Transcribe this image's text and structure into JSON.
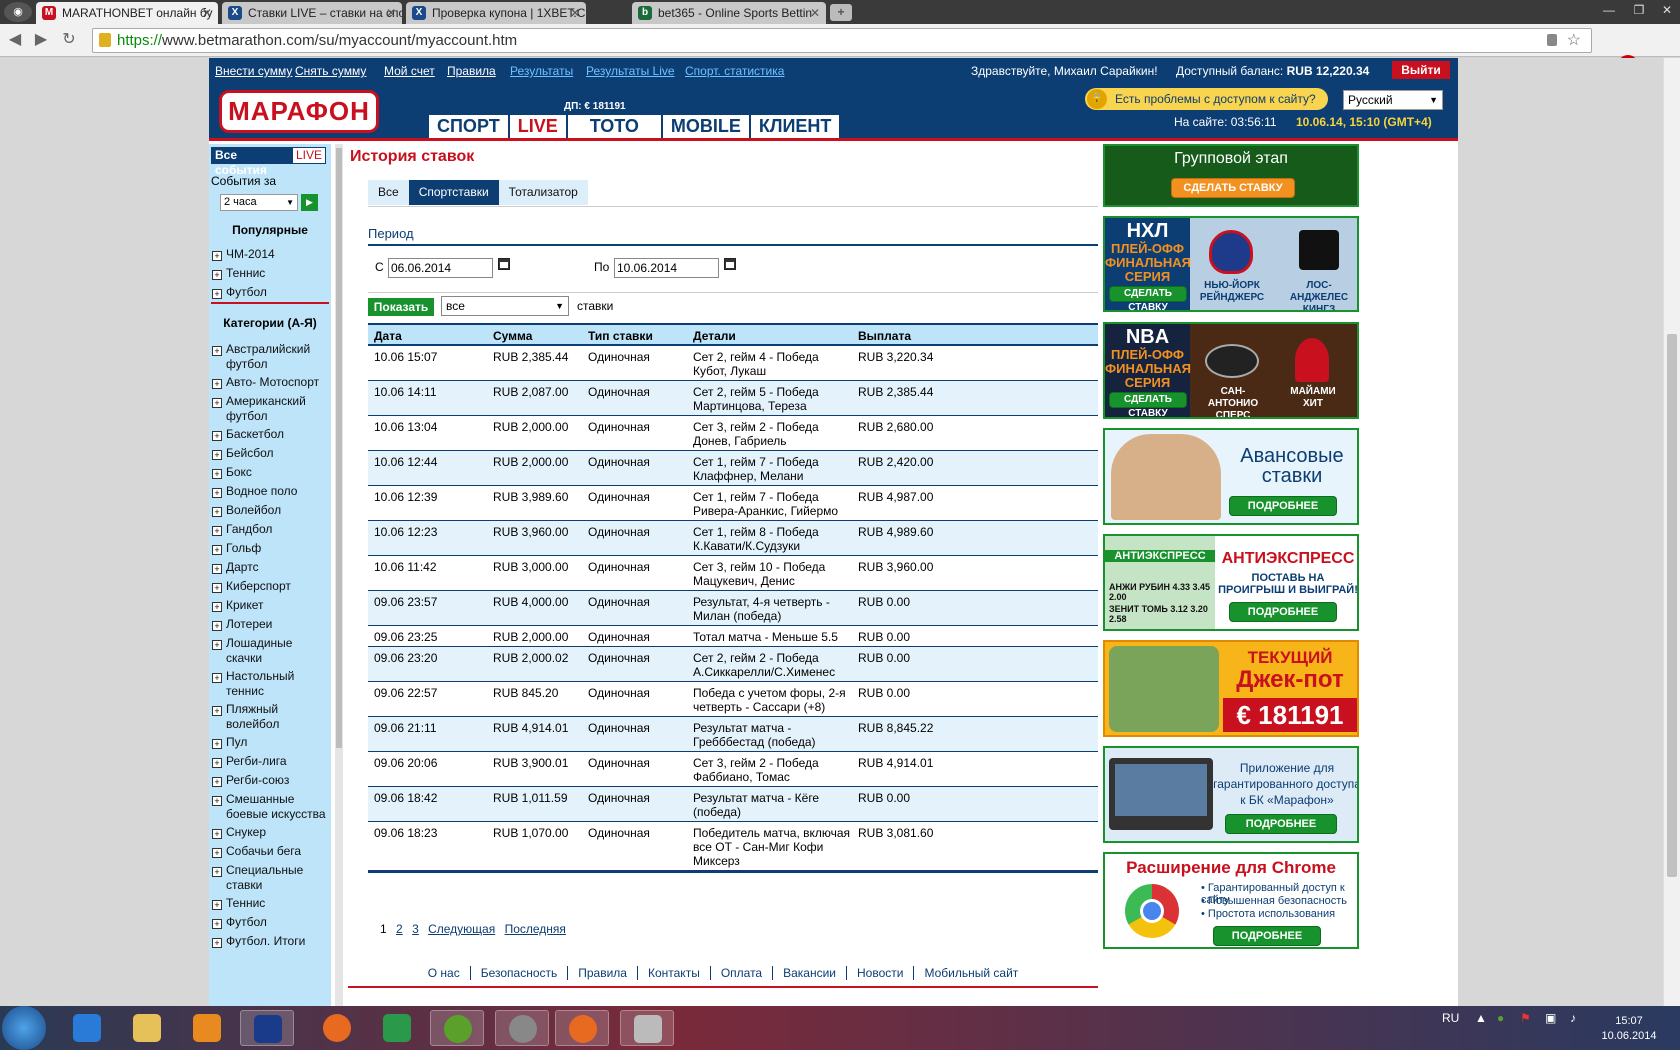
{
  "browser": {
    "tabs": [
      {
        "label": "MARATHONBET онлайн бу",
        "icon": "marathonbet-favicon"
      },
      {
        "label": "Ставки LIVE – ставки на спо",
        "icon": "1xbet-favicon"
      },
      {
        "label": "Проверка купона | 1XBET.C",
        "icon": "1xbet-favicon"
      },
      {
        "label": "bet365 - Online Sports Bettin",
        "icon": "bet365-favicon"
      }
    ],
    "url_scheme": "https://",
    "url_rest": "www.betmarathon.com/su/myaccount/myaccount.htm"
  },
  "topbar": {
    "links": [
      "Внести сумму",
      "Снять сумму",
      "Мой счет",
      "Правила",
      "Результаты",
      "Результаты Live",
      "Спорт. статистика"
    ],
    "greeting": "Здравствуйте, Михаил Сарайкин!",
    "balance_label": "Доступный баланс:",
    "balance_value": "RUB 12,220.34",
    "logout": "Выйти"
  },
  "header": {
    "logo": "МАРАФОН",
    "dp": "ДП: € 181191",
    "nav": [
      "СПОРТ",
      "LIVE",
      "ТОТО",
      "MOBILE",
      "КЛИЕНТ"
    ],
    "access": "Есть проблемы с доступом к сайту?",
    "language": "Русский",
    "onsite": "На сайте: 03:56:11",
    "clock": "10.06.14, 15:10 (GMT+4)"
  },
  "sidebar": {
    "all_events": "Все события",
    "live": "LIVE",
    "events_for": "События за",
    "period": "2 часа",
    "popular_title": "Популярные",
    "popular": [
      "ЧМ-2014",
      "Теннис",
      "Футбол"
    ],
    "categories_title": "Категории (А-Я)",
    "categories": [
      "Австралийский футбол",
      "Авто- Мотоспорт",
      "Американский футбол",
      "Баскетбол",
      "Бейсбол",
      "Бокс",
      "Водное поло",
      "Волейбол",
      "Гандбол",
      "Гольф",
      "Дартс",
      "Киберспорт",
      "Крикет",
      "Лотереи",
      "Лошадиные скачки",
      "Настольный теннис",
      "Пляжный волейбол",
      "Пул",
      "Регби-лига",
      "Регби-союз",
      "Смешанные боевые искусства",
      "Снукер",
      "Собачьи бега",
      "Специальные ставки",
      "Теннис",
      "Футбол",
      "Футбол. Итоги"
    ]
  },
  "main": {
    "title": "История ставок",
    "tabs": [
      "Все",
      "Спортставки",
      "Тотализатор"
    ],
    "period_title": "Период",
    "from_label": "С",
    "from_value": "06.06.2014",
    "to_label": "По",
    "to_value": "10.06.2014",
    "show_button": "Показать",
    "bet_filter": "все",
    "bets_label": "ставки",
    "columns": [
      "Дата",
      "Сумма",
      "Тип ставки",
      "Детали",
      "Выплата"
    ],
    "rows": [
      {
        "date": "10.06 15:07",
        "sum": "RUB 2,385.44",
        "type": "Одиночная",
        "details": "Сет 2, гейм 4 - Победа Кубот, Лукаш",
        "payout": "RUB 3,220.34"
      },
      {
        "date": "10.06 14:11",
        "sum": "RUB 2,087.00",
        "type": "Одиночная",
        "details": "Сет 2, гейм 5 - Победа Мартинцова, Тереза",
        "payout": "RUB 2,385.44"
      },
      {
        "date": "10.06 13:04",
        "sum": "RUB 2,000.00",
        "type": "Одиночная",
        "details": "Сет 3, гейм 2 - Победа Донев, Габриель",
        "payout": "RUB 2,680.00"
      },
      {
        "date": "10.06 12:44",
        "sum": "RUB 2,000.00",
        "type": "Одиночная",
        "details": "Сет 1, гейм 7 - Победа Клаффнер, Мелани",
        "payout": "RUB 2,420.00"
      },
      {
        "date": "10.06 12:39",
        "sum": "RUB 3,989.60",
        "type": "Одиночная",
        "details": "Сет 1, гейм 7 - Победа Ривера-Аранкис, Гийермо",
        "payout": "RUB 4,987.00"
      },
      {
        "date": "10.06 12:23",
        "sum": "RUB 3,960.00",
        "type": "Одиночная",
        "details": "Сет 1, гейм 8 - Победа К.Кавати/К.Судзуки",
        "payout": "RUB 4,989.60"
      },
      {
        "date": "10.06 11:42",
        "sum": "RUB 3,000.00",
        "type": "Одиночная",
        "details": "Сет 3, гейм 10 - Победа Мацукевич, Денис",
        "payout": "RUB 3,960.00"
      },
      {
        "date": "09.06 23:57",
        "sum": "RUB 4,000.00",
        "type": "Одиночная",
        "details": "Результат, 4-я четверть - Милан (победа)",
        "payout": "RUB 0.00"
      },
      {
        "date": "09.06 23:25",
        "sum": "RUB 2,000.00",
        "type": "Одиночная",
        "details": "Тотал матча - Меньше 5.5",
        "payout": "RUB 0.00"
      },
      {
        "date": "09.06 23:20",
        "sum": "RUB 2,000.02",
        "type": "Одиночная",
        "details": "Сет 2, гейм 2 - Победа А.Сиккарелли/С.Хименес",
        "payout": "RUB 0.00"
      },
      {
        "date": "09.06 22:57",
        "sum": "RUB 845.20",
        "type": "Одиночная",
        "details": "Победа с учетом форы, 2-я четверть - Сассари (+8)",
        "payout": "RUB 0.00"
      },
      {
        "date": "09.06 21:11",
        "sum": "RUB 4,914.01",
        "type": "Одиночная",
        "details": "Результат матча - Гребббестад (победа)",
        "payout": "RUB 8,845.22"
      },
      {
        "date": "09.06 20:06",
        "sum": "RUB 3,900.01",
        "type": "Одиночная",
        "details": "Сет 3, гейм 2 - Победа Фаббиано, Томас",
        "payout": "RUB 4,914.01"
      },
      {
        "date": "09.06 18:42",
        "sum": "RUB 1,011.59",
        "type": "Одиночная",
        "details": "Результат матча - Кёге (победа)",
        "payout": "RUB 0.00"
      },
      {
        "date": "09.06 18:23",
        "sum": "RUB 1,070.00",
        "type": "Одиночная",
        "details": "Победитель матча, включая все ОТ - Сан-Миг Кофи Миксерз",
        "payout": "RUB 3,081.60"
      }
    ],
    "pager": {
      "current": "1",
      "pages": [
        "2",
        "3"
      ],
      "next": "Следующая",
      "last": "Последняя"
    },
    "footer": [
      "О нас",
      "Безопасность",
      "Правила",
      "Контакты",
      "Оплата",
      "Вакансии",
      "Новости",
      "Мобильный сайт"
    ]
  },
  "banners": {
    "group": {
      "title": "Групповой этап",
      "button": "СДЕЛАТЬ СТАВКУ"
    },
    "nhl": {
      "league": "НХЛ",
      "subtitle": "ПЛЕЙ-ОФФ ФИНАЛЬНАЯ СЕРИЯ",
      "button": "СДЕЛАТЬ СТАВКУ",
      "team1": "НЬЮ-ЙОРК РЕЙНДЖЕРС",
      "team2": "ЛОС-АНДЖЕЛЕС КИНГЗ"
    },
    "nba": {
      "league": "NBA",
      "subtitle": "ПЛЕЙ-ОФФ ФИНАЛЬНАЯ СЕРИЯ",
      "button": "СДЕЛАТЬ СТАВКУ",
      "team1": "САН-АНТОНИО СПЕРС",
      "team2": "МАЙАМИ ХИТ"
    },
    "advance": {
      "title": "Авансовые ставки",
      "button": "ПОДРОБНЕЕ"
    },
    "antiexpress": {
      "title": "АНТИЭКСПРЕСС",
      "subtitle": "ПОСТАВЬ НА ПРОИГРЫШ И ВЫИГРАЙ!",
      "button": "ПОДРОБНЕЕ",
      "box_title": "АНТИЭКСПРЕСС",
      "row1": "АНЖИ РУБИН 4.33 3.45 2.00",
      "row2": "ЗЕНИТ ТОМЬ 3.12 3.20 2.58"
    },
    "jackpot": {
      "line1": "ТЕКУЩИЙ",
      "line2": "Джек-пот",
      "amount": "€ 181191"
    },
    "app": {
      "title": "Приложение для гарантированного доступа к БК «Марафон»",
      "button": "ПОДРОБНЕЕ"
    },
    "chrome": {
      "title": "Расширение для Chrome",
      "items": [
        "• Гарантированный доступ к сайту",
        "• Повышенная безопасность",
        "• Простота использования"
      ],
      "button": "ПОДРОБНЕЕ"
    }
  },
  "taskbar": {
    "lang": "RU",
    "time": "15:07",
    "date": "10.06.2014"
  }
}
